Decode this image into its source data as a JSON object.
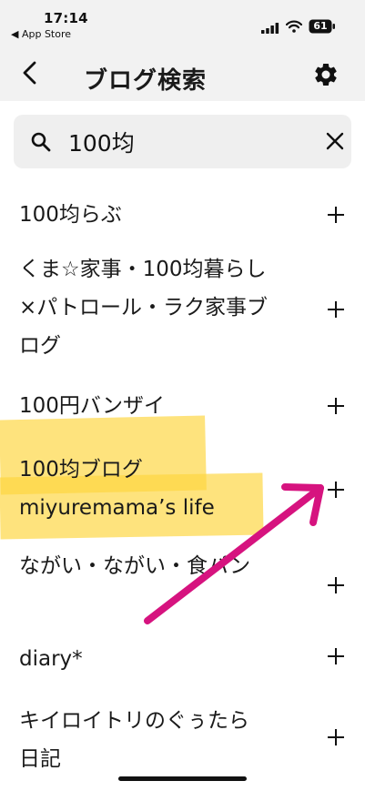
{
  "status_bar": {
    "time": "17:14",
    "back_app": "◀ App Store",
    "battery": "61"
  },
  "nav": {
    "title": "ブログ検索"
  },
  "search": {
    "value": "100均"
  },
  "results": [
    {
      "label": "100均らぶ"
    },
    {
      "label": "くま☆家事・100均暮らし×パトロール・ラク家事ブログ"
    },
    {
      "label": "100円バンザイ"
    },
    {
      "label": "100均ブログ miyuremama’s life"
    },
    {
      "label": "ながい・ながい・食パン"
    },
    {
      "label": "diary*"
    },
    {
      "label": "キイロイトリのぐぅたら日記"
    }
  ],
  "colors": {
    "highlight": "#fdd640",
    "arrow": "#d6137f",
    "top_bar": "#f2f2f2"
  },
  "icons": [
    "chevron-left-icon",
    "gear-icon",
    "search-icon",
    "close-icon",
    "plus-icon"
  ]
}
